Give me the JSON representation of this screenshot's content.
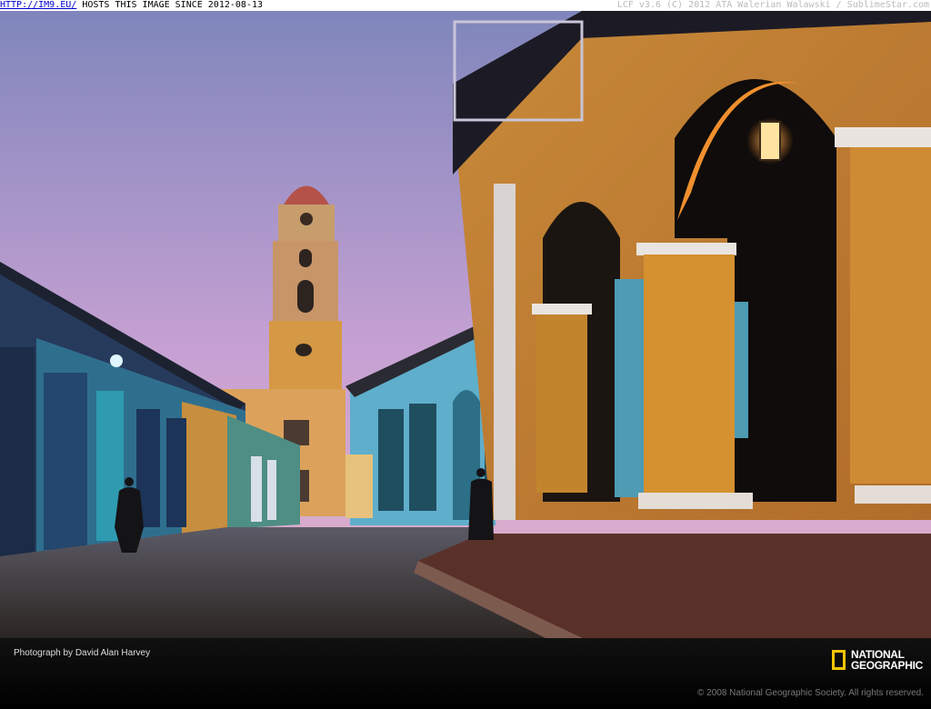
{
  "topbar": {
    "link": "HTTP://IM9.EU/",
    "text": " HOSTS THIS IMAGE SINCE 2012-08-13",
    "right": "LCF v3.6 (C) 2012 ATA Walerian Walawski / SublimeStar.com"
  },
  "footer": {
    "credit": "Photograph by David Alan Harvey",
    "logo_line1": "NATIONAL",
    "logo_line2": "GEOGRAPHIC",
    "copyright": "© 2008 National Geographic Society. All rights reserved."
  },
  "colors": {
    "sky_top": "#8a8bbd",
    "sky_bottom": "#d9a6cf",
    "ochre": "#d89a3c",
    "turquoise": "#4aa7c4",
    "logo_yellow": "#f5c400"
  }
}
